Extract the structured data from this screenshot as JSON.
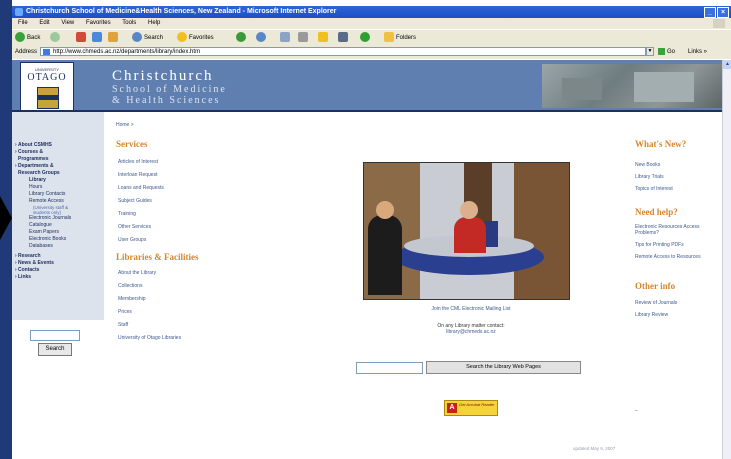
{
  "window": {
    "title": "Christchurch School of Medicine&Health Sciences, New Zealand - Microsoft Internet Explorer"
  },
  "menu": [
    "File",
    "Edit",
    "View",
    "Favorites",
    "Tools",
    "Help"
  ],
  "toolbar": {
    "back": "Back",
    "search": "Search",
    "favorites": "Favorites",
    "folders": "Folders"
  },
  "address": {
    "label": "Address",
    "url": "http://www.chmeds.ac.nz/departments/library/index.htm",
    "go": "Go",
    "links": "Links"
  },
  "header": {
    "logo_university": "UNIVERSITY",
    "logo_name": "OTAGO",
    "logo_motto": "Te Whare Wānanga o Otāgo",
    "brand_line1": "Christchurch",
    "brand_line2": "School of Medicine",
    "brand_line3": "& Health Sciences"
  },
  "sidebar": {
    "items": [
      {
        "label": "About CSMHS"
      },
      {
        "label": "Courses &"
      },
      {
        "label": "Programmes"
      },
      {
        "label": "Departments &"
      },
      {
        "label": "Research Groups"
      }
    ],
    "sub": [
      "Library",
      "Hours",
      "Library Contacts",
      "Remote Access"
    ],
    "note": [
      "(University staff &",
      "students only)"
    ],
    "sub2": [
      "Electronic Journals",
      "Catalogue",
      "Exam Papers",
      "Electronic Books",
      "Databases"
    ],
    "items2": [
      "Research",
      "News & Events",
      "Contacts",
      "Links"
    ],
    "search_button": "Search"
  },
  "breadcrumb": "Home >",
  "services": {
    "heading": "Services",
    "links": [
      "Articles of Interest",
      "Interloan Request",
      "Loans and Requests",
      "Subject Guides",
      "Training",
      "Other Services",
      "User Groups"
    ]
  },
  "libraries": {
    "heading": "Libraries & Facilities",
    "links": [
      "About the Library",
      "Collections",
      "Membership",
      "Prices",
      "Staff",
      "University of Otago Libraries"
    ]
  },
  "center": {
    "mailing_list": "Join the CML Electronic Mailing List",
    "contact_line": "On any Library matter contact:",
    "contact_email": "library@chmeds.ac.nz",
    "search_button": "Search the Library Web Pages",
    "acrobat": "Get Acrobat Reader"
  },
  "whats_new": {
    "heading": "What's New?",
    "links": [
      "New Books",
      "Library Trials",
      "Topics of Interest"
    ]
  },
  "need_help": {
    "heading": "Need help?",
    "links": [
      "Electronic Resources Access Problems?",
      "Tips for Printing PDFs",
      "Remote Access to Resources"
    ]
  },
  "other_info": {
    "heading": "Other info",
    "links": [
      "Review of Journals",
      "Library Review"
    ]
  },
  "footer": {
    "dash": "–",
    "updated": "updated May 9, 2007"
  }
}
